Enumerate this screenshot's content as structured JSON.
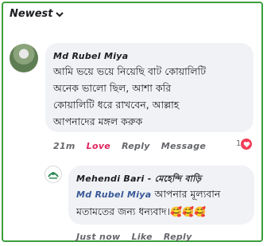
{
  "sort": {
    "label": "Newest"
  },
  "comment": {
    "author": "Md Rubel Miya",
    "text_lines": [
      "আমি ভয়ে ভয়ে নিয়েছি বাট কোয়ালিটি",
      "অনেক ভালো  ছিল, আশা করি",
      "কোয়ালিটি ধরে রাখবেন, আল্লাহ",
      "আপনাদের মঙ্গল করুক"
    ],
    "time": "21m",
    "love_label": "Love",
    "reply_label": "Reply",
    "message_label": "Message",
    "reaction_count": "1",
    "reaction_icon": "heart-icon"
  },
  "reply": {
    "author": "Mehendi Bari - মেহেন্দি বাড়ি",
    "mention": "Md Rubel Miya",
    "text_line1": " আপনার মূল্যবান",
    "text_line2": "মতামতের জন্য ধন্যবাদ।",
    "emojis": "🥰🥰🥰",
    "time": "Just now",
    "like_label": "Like",
    "reply_label": "Reply"
  },
  "colors": {
    "frame_border": "#3c9e3c",
    "bubble": "#f0f2f5",
    "love": "#e0245e",
    "mention": "#385898"
  }
}
